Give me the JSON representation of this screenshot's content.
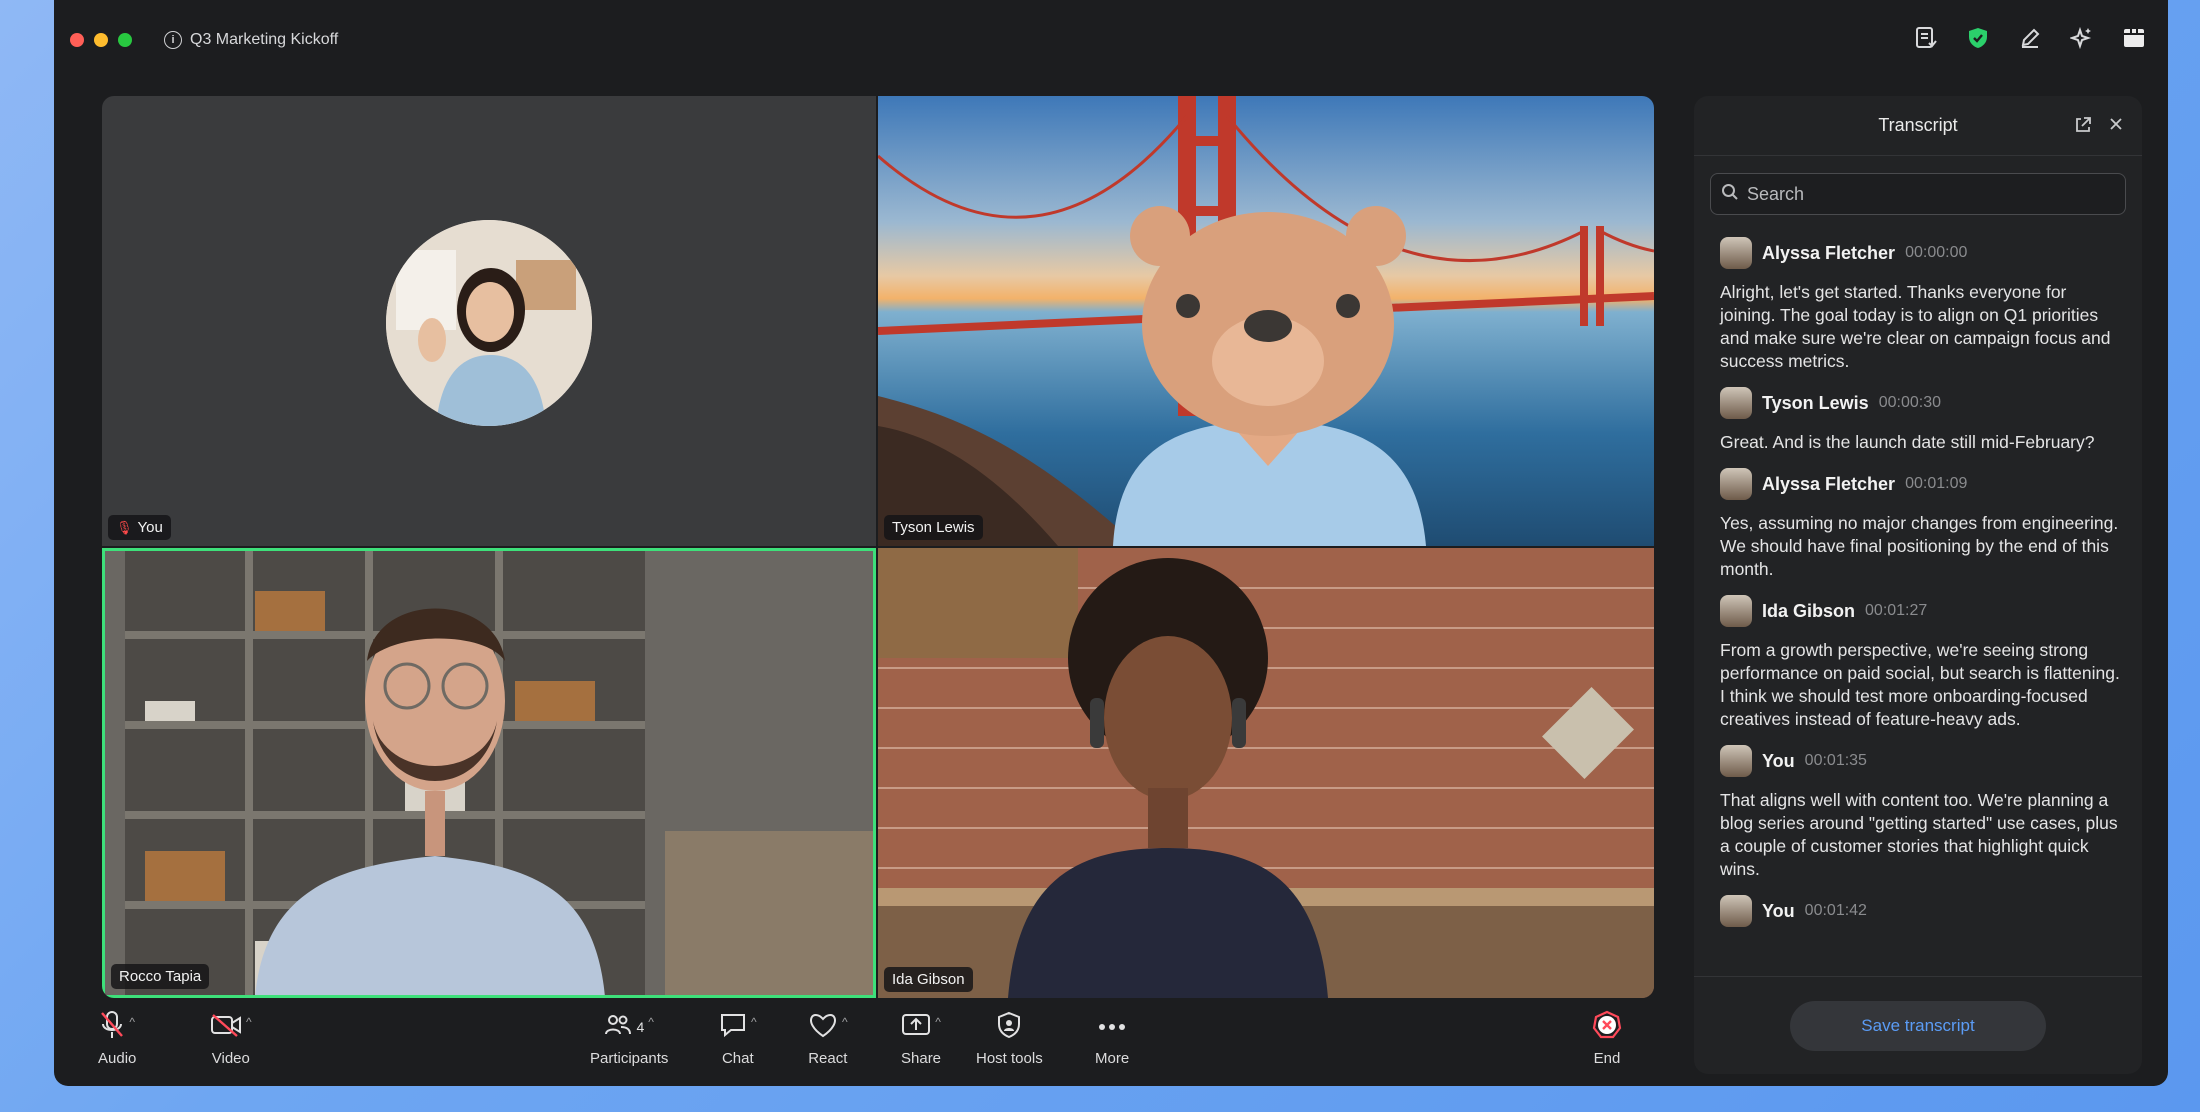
{
  "window": {
    "title": "Q3 Marketing Kickoff"
  },
  "tiles": [
    {
      "name": "You"
    },
    {
      "name": "Tyson Lewis"
    },
    {
      "name": "Rocco Tapia"
    },
    {
      "name": "Ida Gibson"
    }
  ],
  "transcript": {
    "title": "Transcript",
    "search_placeholder": "Search",
    "entries": [
      {
        "speaker": "Alyssa Fletcher",
        "time": "00:00:00",
        "text": "Alright, let's get started. Thanks everyone for joining. The goal today is to align on Q1 priorities and make sure we're clear on campaign focus and success metrics."
      },
      {
        "speaker": "Tyson Lewis",
        "time": "00:00:30",
        "text": "Great. And is the launch date still mid-February?"
      },
      {
        "speaker": "Alyssa Fletcher",
        "time": "00:01:09",
        "text": "Yes, assuming no major changes from engineering. We should have final positioning by the end of this month."
      },
      {
        "speaker": "Ida Gibson",
        "time": "00:01:27",
        "text": "From a growth perspective, we're seeing strong performance on paid social, but search is flattening. I think we should test more onboarding-focused creatives instead of feature-heavy ads."
      },
      {
        "speaker": "You",
        "time": "00:01:35",
        "text": "That aligns well with content too. We're planning a blog series around \"getting started\" use cases, plus a couple of customer stories that highlight quick wins."
      },
      {
        "speaker": "You",
        "time": "00:01:42",
        "text": ""
      }
    ],
    "save_label": "Save transcript"
  },
  "toolbar": {
    "audio": "Audio",
    "video": "Video",
    "participants": "Participants",
    "participants_count": "4",
    "chat": "Chat",
    "react": "React",
    "share": "Share",
    "host_tools": "Host tools",
    "more": "More",
    "end": "End"
  },
  "colors": {
    "active_speaker_border": "#3ee07a",
    "end_red": "#ff4a5a",
    "save_text": "#5b9cf5",
    "shield_green": "#2bd06b"
  }
}
